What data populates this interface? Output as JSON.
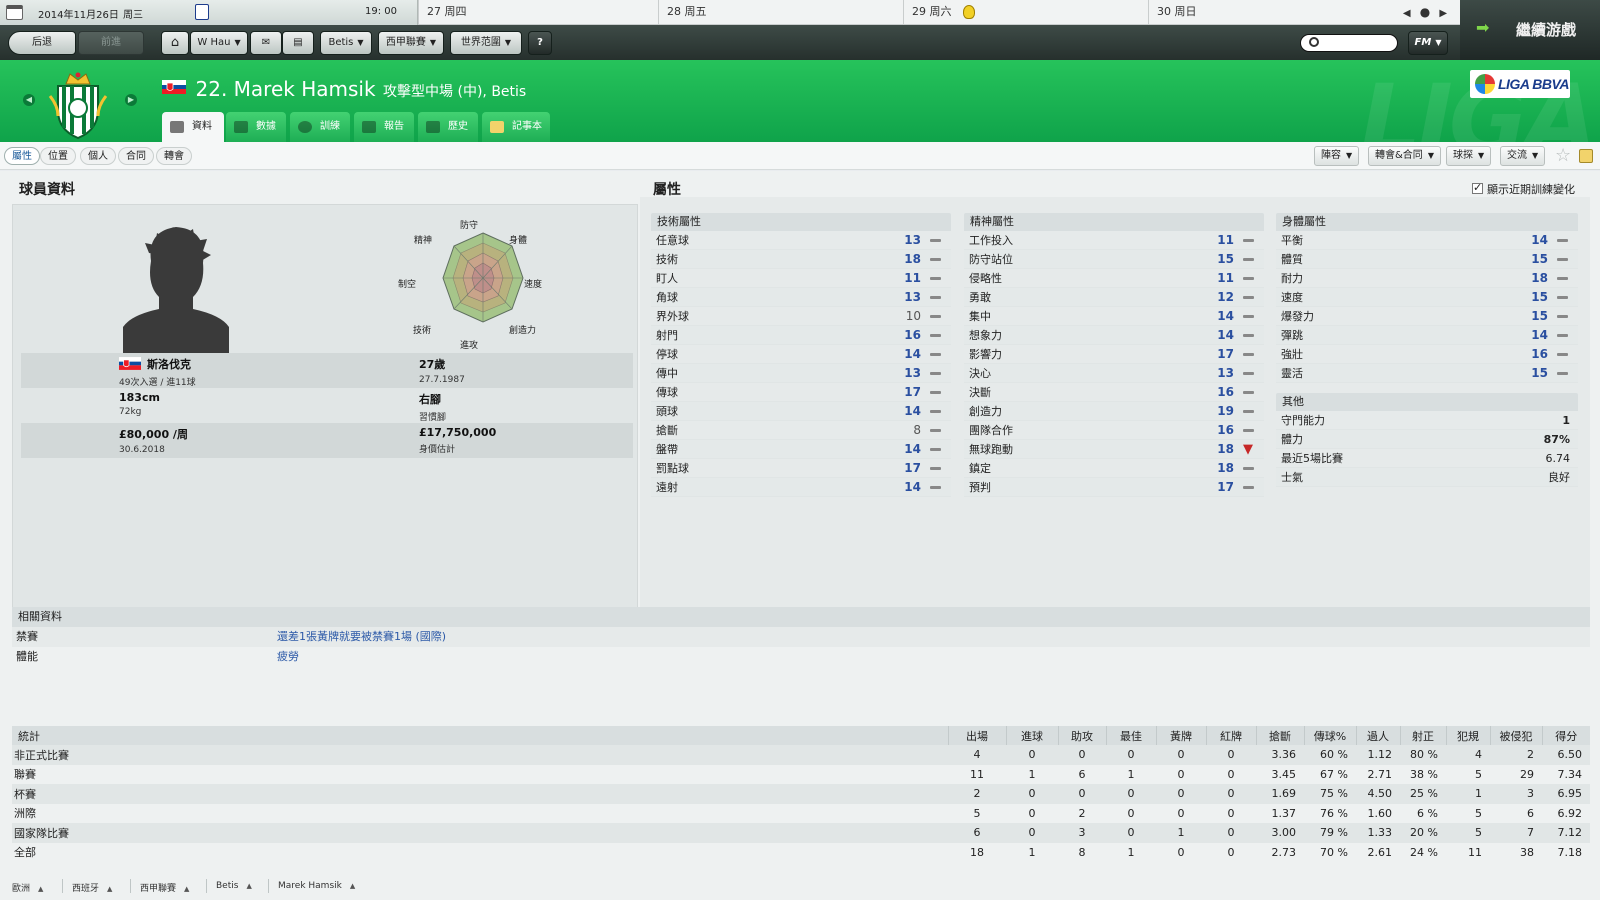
{
  "calendar": {
    "today": "2014年11月26日",
    "today_weekday": "周三",
    "time": "19: 00",
    "days": [
      {
        "label": "27 周四"
      },
      {
        "label": "28 周五"
      },
      {
        "label": "29 周六"
      },
      {
        "label": "30 周日"
      }
    ]
  },
  "toolbar": {
    "back": "后退",
    "forward": "前進",
    "manager": "W Hau",
    "club": "Betis",
    "league": "西甲聯賽",
    "world": "世界范圍",
    "help": "?",
    "search_placeholder": "",
    "fm": "FM",
    "continue": "繼續游戲"
  },
  "header": {
    "number_name": "22. Marek Hamsik",
    "position_club": "攻擊型中場 (中), Betis",
    "league_logo": "LIGA BBVA",
    "watermark": "LIGA",
    "tabs": [
      "資料",
      "數據",
      "訓練",
      "報告",
      "歷史",
      "記事本"
    ]
  },
  "subtabs": [
    "屬性",
    "位置",
    "個人",
    "合同",
    "轉會"
  ],
  "right_buttons": [
    "陣容",
    "轉會&合同",
    "球探",
    "交流"
  ],
  "profile": {
    "section_title": "球員資料",
    "nationality": "斯洛伐克",
    "caps": "49次入選 / 進11球",
    "age": "27歲",
    "dob": "27.7.1987",
    "height": "183cm",
    "weight": "72kg",
    "foot": "右腳",
    "foot_label": "習慣腳",
    "wage": "£80,000 /周",
    "contract_end": "30.6.2018",
    "value": "£17,750,000",
    "value_label": "身價估計",
    "radar_labels": [
      "防守",
      "身體",
      "速度",
      "創造力",
      "進攻",
      "技術",
      "制空",
      "精神"
    ]
  },
  "attributes": {
    "section_title": "屬性",
    "show_training": "顯示近期訓練變化",
    "technical": {
      "title": "技術屬性",
      "items": [
        {
          "name": "任意球",
          "value": "13"
        },
        {
          "name": "技術",
          "value": "18"
        },
        {
          "name": "盯人",
          "value": "11"
        },
        {
          "name": "角球",
          "value": "13"
        },
        {
          "name": "界外球",
          "value": "10"
        },
        {
          "name": "射門",
          "value": "16"
        },
        {
          "name": "停球",
          "value": "14"
        },
        {
          "name": "傳中",
          "value": "13"
        },
        {
          "name": "傳球",
          "value": "17"
        },
        {
          "name": "頭球",
          "value": "14"
        },
        {
          "name": "搶斷",
          "value": "8"
        },
        {
          "name": "盤帶",
          "value": "14"
        },
        {
          "name": "罰點球",
          "value": "17"
        },
        {
          "name": "遠射",
          "value": "14"
        }
      ]
    },
    "mental": {
      "title": "精神屬性",
      "items": [
        {
          "name": "工作投入",
          "value": "11"
        },
        {
          "name": "防守站位",
          "value": "15"
        },
        {
          "name": "侵略性",
          "value": "11"
        },
        {
          "name": "勇敢",
          "value": "12"
        },
        {
          "name": "集中",
          "value": "14"
        },
        {
          "name": "想象力",
          "value": "14"
        },
        {
          "name": "影響力",
          "value": "17"
        },
        {
          "name": "決心",
          "value": "13"
        },
        {
          "name": "決斷",
          "value": "16"
        },
        {
          "name": "創造力",
          "value": "19"
        },
        {
          "name": "團隊合作",
          "value": "16"
        },
        {
          "name": "無球跑動",
          "value": "18",
          "trend": "down"
        },
        {
          "name": "鎮定",
          "value": "18"
        },
        {
          "name": "預判",
          "value": "17"
        }
      ]
    },
    "physical": {
      "title": "身體屬性",
      "items": [
        {
          "name": "平衡",
          "value": "14"
        },
        {
          "name": "體質",
          "value": "15"
        },
        {
          "name": "耐力",
          "value": "18"
        },
        {
          "name": "速度",
          "value": "15"
        },
        {
          "name": "爆發力",
          "value": "15"
        },
        {
          "name": "彈跳",
          "value": "14"
        },
        {
          "name": "強壯",
          "value": "16"
        },
        {
          "name": "靈活",
          "value": "15"
        }
      ]
    },
    "other": {
      "title": "其他",
      "items": [
        {
          "name": "守門能力",
          "value": "1"
        },
        {
          "name": "體力",
          "value": "87%"
        },
        {
          "name": "最近5場比賽",
          "value": "6.74"
        },
        {
          "name": "士氣",
          "value": "良好"
        }
      ]
    }
  },
  "related": {
    "title": "相關資料",
    "rows": [
      {
        "label": "禁賽",
        "value": "還差1張黃牌就要被禁賽1場 (國際)"
      },
      {
        "label": "體能",
        "value": "疲勞"
      }
    ]
  },
  "stats": {
    "title": "統計",
    "columns": [
      "出場",
      "進球",
      "助攻",
      "最佳",
      "黃牌",
      "紅牌",
      "搶斷",
      "傳球%",
      "過人",
      "射正",
      "犯規",
      "被侵犯",
      "得分"
    ],
    "rows": [
      {
        "label": "非正式比賽",
        "values": [
          "4",
          "0",
          "0",
          "0",
          "0",
          "0",
          "3.36",
          "60 %",
          "1.12",
          "80 %",
          "4",
          "2",
          "6.50"
        ]
      },
      {
        "label": "聯賽",
        "values": [
          "11",
          "1",
          "6",
          "1",
          "0",
          "0",
          "3.45",
          "67 %",
          "2.71",
          "38 %",
          "5",
          "29",
          "7.34"
        ]
      },
      {
        "label": "杯賽",
        "values": [
          "2",
          "0",
          "0",
          "0",
          "0",
          "0",
          "1.69",
          "75 %",
          "4.50",
          "25 %",
          "1",
          "3",
          "6.95"
        ]
      },
      {
        "label": "洲際",
        "values": [
          "5",
          "0",
          "2",
          "0",
          "0",
          "0",
          "1.37",
          "76 %",
          "1.60",
          "6 %",
          "5",
          "6",
          "6.92"
        ]
      },
      {
        "label": "國家隊比賽",
        "values": [
          "6",
          "0",
          "3",
          "0",
          "1",
          "0",
          "3.00",
          "79 %",
          "1.33",
          "20 %",
          "5",
          "7",
          "7.12"
        ]
      },
      {
        "label": "全部",
        "values": [
          "18",
          "1",
          "8",
          "1",
          "0",
          "0",
          "2.73",
          "70 %",
          "2.61",
          "24 %",
          "11",
          "38",
          "7.18"
        ]
      }
    ]
  },
  "breadcrumbs": [
    "歐洲",
    "西班牙",
    "西甲聯賽",
    "Betis",
    "Marek Hamsik"
  ],
  "colors": {
    "header_green": "#18b050",
    "value_blue": "#2a4fa0",
    "trend_down": "#c62828"
  }
}
